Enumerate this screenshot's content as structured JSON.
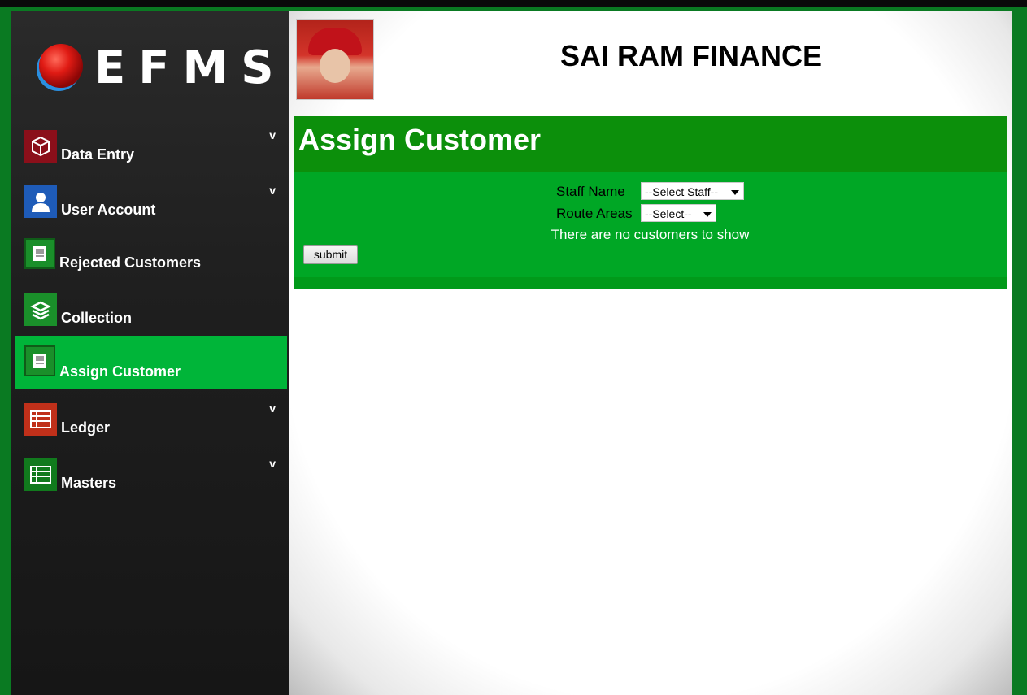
{
  "app": {
    "logo_text": "EFMS",
    "title": "SAI RAM FINANCE"
  },
  "sidebar": {
    "items": [
      {
        "label": "Data Entry",
        "icon": "box-icon",
        "has_submenu": true,
        "chevron": "v",
        "color": "#8b0f1a"
      },
      {
        "label": "User Account",
        "icon": "user-icon",
        "has_submenu": true,
        "chevron": "v",
        "color": "#1e5bb8"
      },
      {
        "label": "Rejected Customers",
        "icon": "document-icon",
        "has_submenu": false,
        "color": "#1a8f2a"
      },
      {
        "label": "Collection",
        "icon": "stack-icon",
        "has_submenu": false,
        "color": "#1a8f2a"
      },
      {
        "label": "Assign Customer",
        "icon": "document-icon",
        "has_submenu": false,
        "active": true,
        "color": "#1a8f2a"
      },
      {
        "label": "Ledger",
        "icon": "ledger-icon",
        "has_submenu": true,
        "chevron": "v",
        "color": "#c0301a"
      },
      {
        "label": "Masters",
        "icon": "table-icon",
        "has_submenu": true,
        "chevron": "v",
        "color": "#117a1d"
      }
    ]
  },
  "panel": {
    "title": "Assign Customer",
    "staff_label": "Staff Name",
    "staff_value": "--Select Staff--",
    "route_label": "Route Areas",
    "route_value": "--Select--",
    "message": "There are no customers to show",
    "submit_label": "submit"
  },
  "colors": {
    "active_menu": "#00b539",
    "panel_header": "#0c8f0b",
    "panel_body": "#00a725",
    "frame": "#0a7a22"
  }
}
